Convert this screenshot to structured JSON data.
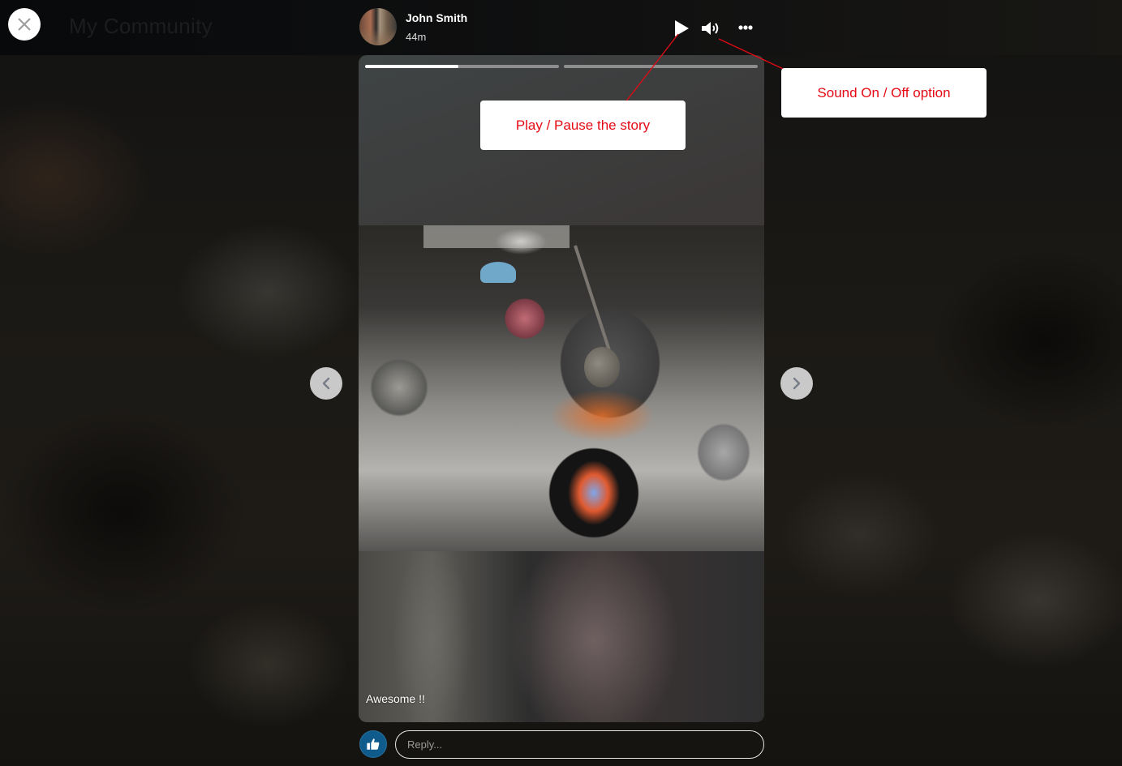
{
  "background": {
    "page_title": "My Community"
  },
  "viewer": {
    "close_icon": "close-icon",
    "author": {
      "name": "John Smith",
      "time_ago": "44m"
    },
    "controls": {
      "play_icon": "play-icon",
      "sound_icon": "volume-on-icon",
      "more_icon": "more-horizontal-icon"
    },
    "progress": [
      {
        "segment": 1,
        "percent": 48
      },
      {
        "segment": 2,
        "percent": 0
      }
    ],
    "caption": "Awesome !!",
    "navigation": {
      "prev_icon": "chevron-left-icon",
      "next_icon": "chevron-right-icon"
    },
    "reply": {
      "like_icon": "thumbs-up-icon",
      "placeholder": "Reply...",
      "value": ""
    }
  },
  "annotations": {
    "color": "#e50914",
    "play_pause": "Play / Pause the story",
    "sound": "Sound On / Off option"
  }
}
